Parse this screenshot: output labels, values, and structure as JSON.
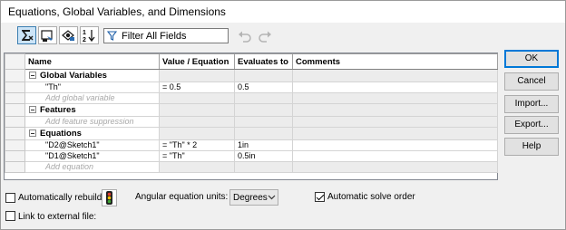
{
  "window": {
    "title": "Equations, Global Variables, and Dimensions"
  },
  "toolbar": {
    "icons": [
      "equation-view-icon",
      "sketch-equation-view-icon",
      "dimension-view-icon",
      "ordered-view-icon"
    ],
    "filter": {
      "icon": "filter-icon",
      "value": "Filter All Fields"
    },
    "undo_icon": "undo-icon",
    "redo_icon": "redo-icon"
  },
  "table": {
    "headers": [
      "Name",
      "Value / Equation",
      "Evaluates to",
      "Comments"
    ],
    "global_variables": {
      "label": "Global Variables",
      "rows": [
        {
          "name": "\"Th\"",
          "value": "= 0.5",
          "evaluates": "0.5",
          "comment": ""
        }
      ],
      "add_placeholder": "Add global variable"
    },
    "features": {
      "label": "Features",
      "add_placeholder": "Add feature suppression"
    },
    "equations": {
      "label": "Equations",
      "rows": [
        {
          "name": "\"D2@Sketch1\"",
          "value": "= \"Th\" * 2",
          "evaluates": "1in",
          "comment": ""
        },
        {
          "name": "\"D1@Sketch1\"",
          "value": "= \"Th\"",
          "evaluates": "0.5in",
          "comment": ""
        }
      ],
      "add_placeholder": "Add equation"
    }
  },
  "buttons": {
    "ok": "OK",
    "cancel": "Cancel",
    "import": "Import...",
    "export": "Export...",
    "help": "Help"
  },
  "options": {
    "auto_rebuild": {
      "label": "Automatically rebuild",
      "checked": false
    },
    "angular_units_label": "Angular equation units:",
    "angular_units_value": "Degrees",
    "auto_solve": {
      "label": "Automatic solve order",
      "checked": true
    },
    "link_external": {
      "label": "Link to external file:",
      "checked": false
    }
  }
}
